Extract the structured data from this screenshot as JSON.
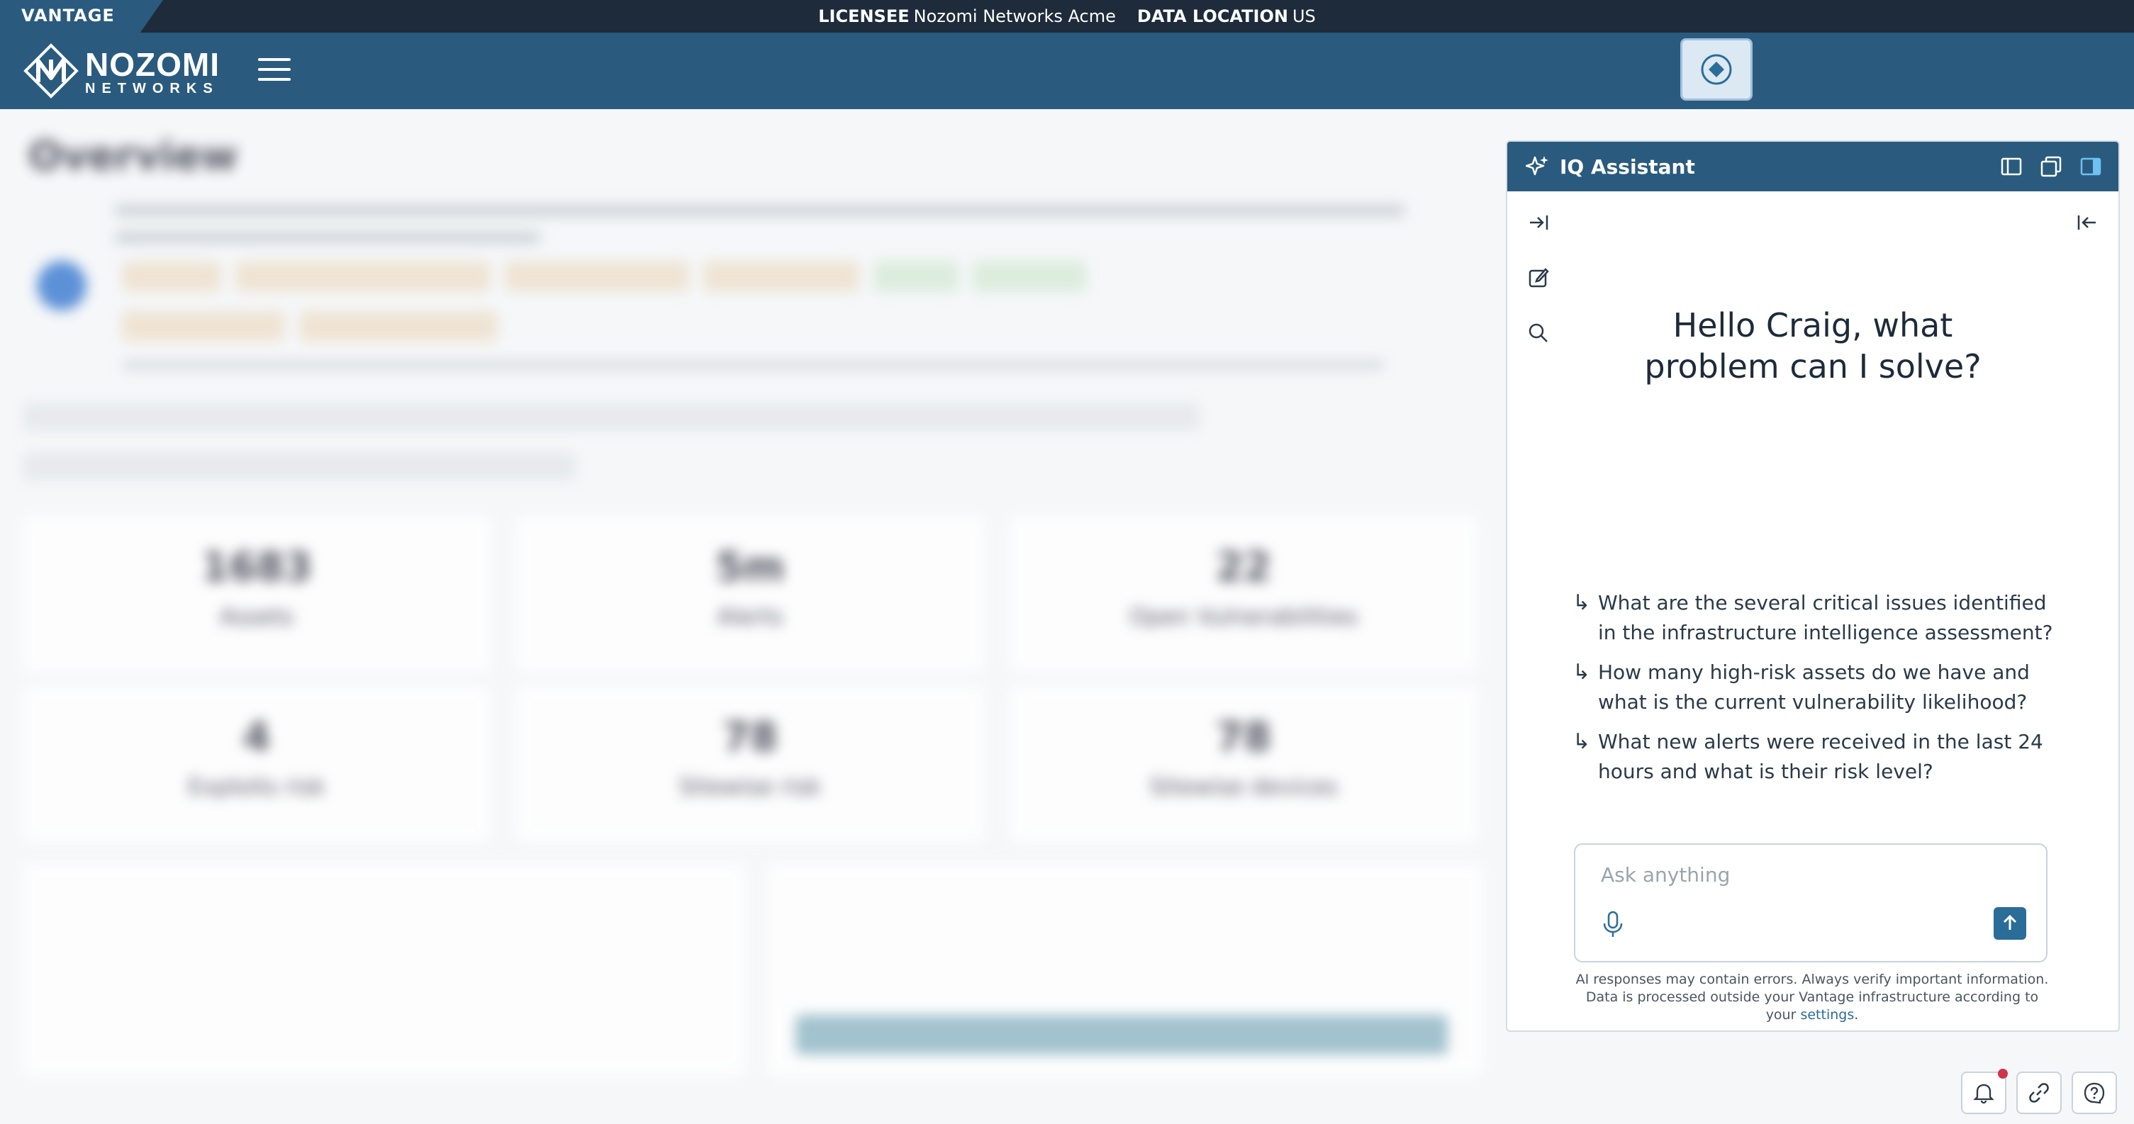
{
  "license_bar": {
    "brand": "VANTAGE",
    "licensee_label": "LICENSEE",
    "licensee_value": "Nozomi Networks Acme",
    "location_label": "DATA LOCATION",
    "location_value": "US"
  },
  "header": {
    "logo_main": "NOZOMI",
    "logo_sub": "NETWORKS"
  },
  "background": {
    "title": "Overview",
    "cards": [
      {
        "value": "1683",
        "label": "Assets"
      },
      {
        "value": "5m",
        "label": "Alerts"
      },
      {
        "value": "22",
        "label": "Open Vulnerabilities"
      },
      {
        "value": "4",
        "label": "Exploits risk"
      },
      {
        "value": "78",
        "label": "Sitewise risk"
      },
      {
        "value": "78",
        "label": "Sitewise devices"
      }
    ]
  },
  "assistant": {
    "title": "IQ Assistant",
    "greeting": "Hello Craig, what problem can I solve?",
    "suggestions": [
      "What are the several critical issues identified in the infrastructure intelligence assessment?",
      "How many high-risk assets do we have and what is the current vulnerability likelihood?",
      "What new alerts were received in the last 24 hours and what is their risk level?"
    ],
    "input_placeholder": "Ask anything",
    "disclaimer_text": "AI responses may contain errors. Always verify important information. Data is processed outside your Vantage infrastructure according to your",
    "settings_link": "settings",
    "disclaimer_end": "."
  },
  "colors": {
    "header": "#2a5b7e",
    "license_bar": "#1d2b3a",
    "accent": "#2a6d99",
    "notification": "#d0344a"
  }
}
